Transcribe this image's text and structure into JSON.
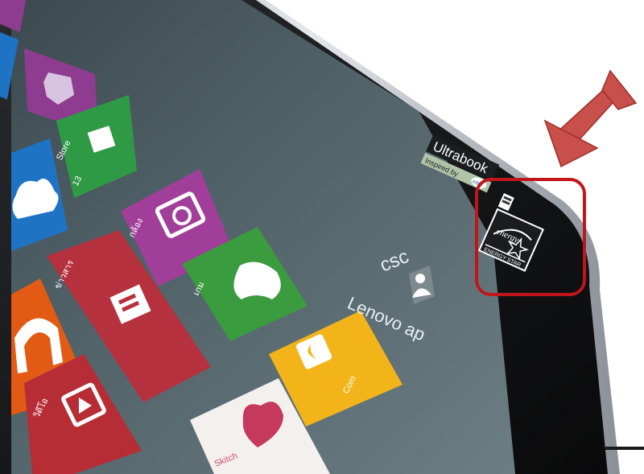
{
  "photo": {
    "description_tiles": [
      {
        "id": "puzzle",
        "color": "#8e3c8f"
      },
      {
        "id": "store",
        "color": "#2f9a46",
        "label": "Store",
        "badge": "13"
      },
      {
        "id": "onedrive",
        "color": "#1f73c4"
      },
      {
        "id": "camera",
        "color": "#a13e99",
        "label": "กล้อง"
      },
      {
        "id": "games",
        "color": "#3a9b3f",
        "label": "เกม"
      },
      {
        "id": "news",
        "color": "#b5313d",
        "label": "ข่าวสาร"
      },
      {
        "id": "music",
        "color": "#e25a14"
      },
      {
        "id": "video",
        "color": "#b72d35",
        "label": "วิดีโอ"
      },
      {
        "id": "lenovo-companion",
        "color": "#f3b419",
        "label": "Com"
      },
      {
        "id": "sketchbook",
        "color": "#f4f0ee",
        "label": "Skitch"
      }
    ],
    "user_name": "csc",
    "group_title": "Lenovo ap",
    "ultrabook_logo": "Ultrabook",
    "ultrabook_tagline": "Inspired by",
    "intel_logo": "intel",
    "energy_star_logo": "ENERGY STAR",
    "energy_script": "energy",
    "highlight_color": "#c0161b",
    "arrow_color": "#c9504a"
  }
}
